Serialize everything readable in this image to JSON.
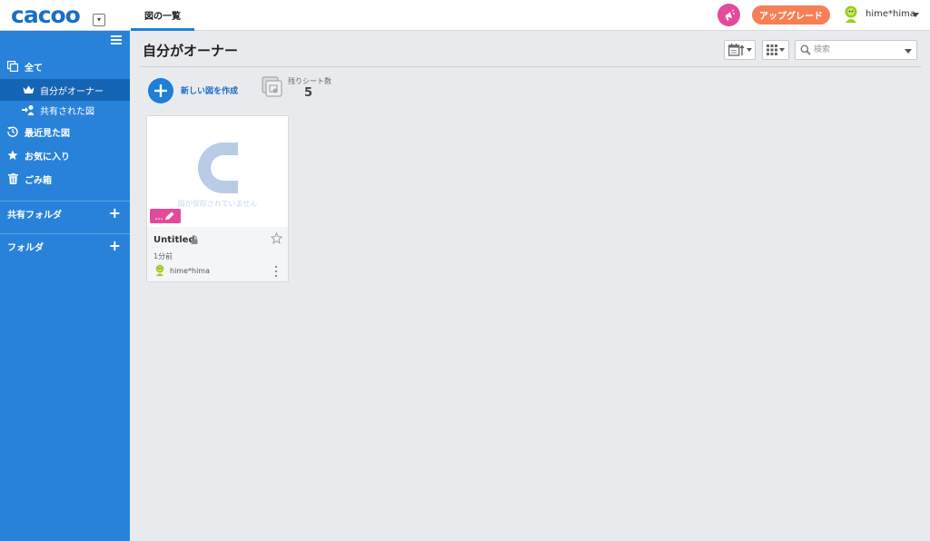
{
  "header": {
    "logo_text": "cacoo",
    "tab_label": "図の一覧",
    "upgrade_label": "アップグレード",
    "user_name": "hime*hima"
  },
  "sidebar": {
    "items": [
      {
        "label": "全て",
        "icon": "copy-icon"
      },
      {
        "label": "自分がオーナー",
        "icon": "crown-icon"
      },
      {
        "label": "共有された図",
        "icon": "shared-user-icon"
      },
      {
        "label": "最近見た図",
        "icon": "history-icon"
      },
      {
        "label": "お気に入り",
        "icon": "star-icon"
      },
      {
        "label": "ごみ箱",
        "icon": "trash-icon"
      }
    ],
    "sections": [
      {
        "label": "共有フォルダ"
      },
      {
        "label": "フォルダ"
      }
    ]
  },
  "main": {
    "title": "自分がオーナー",
    "search_placeholder": "検索",
    "new_diagram_label": "新しい図を作成",
    "sheets_label": "残りシート数",
    "sheets_count": "5"
  },
  "cards": [
    {
      "title": "Untitled",
      "thumb_text": "図が保存されていません",
      "time": "1分前",
      "owner": "hime*hima"
    }
  ],
  "colors": {
    "sidebar": "#2882d9",
    "sidebar_active": "#1565b4",
    "accent": "#1d7fd6",
    "upgrade": "#f77f56",
    "pink": "#e44a9a"
  }
}
